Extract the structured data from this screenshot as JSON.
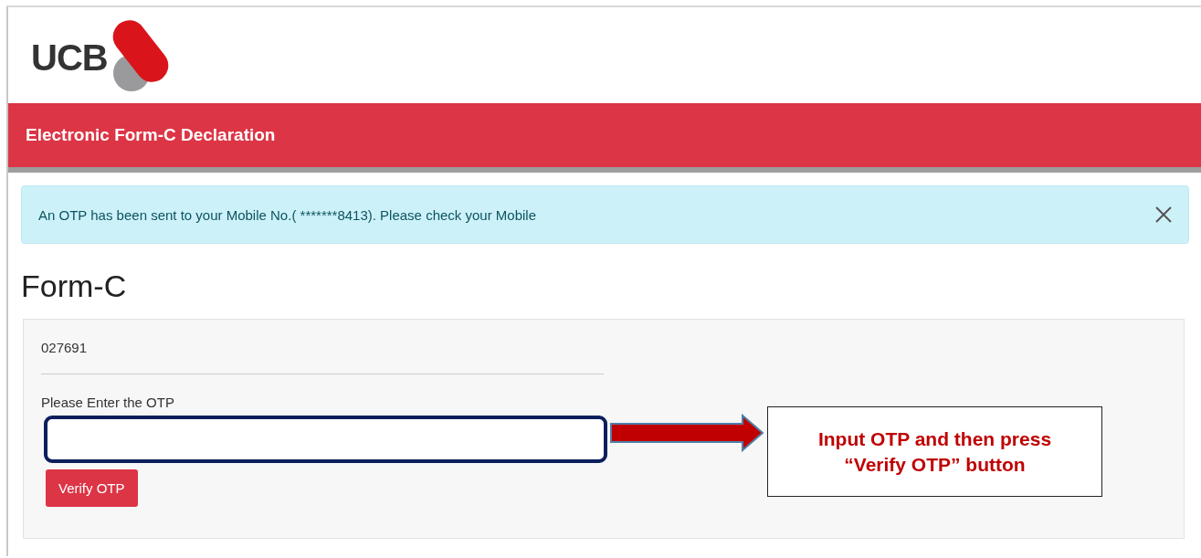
{
  "logo": {
    "text": "UCB"
  },
  "header": {
    "title": "Electronic Form-C Declaration"
  },
  "alert": {
    "message": "An OTP has been sent to your Mobile No.( *******8413). Please check your Mobile"
  },
  "heading": "Form-C",
  "form": {
    "reference": "027691",
    "label": "Please Enter the OTP",
    "button": "Verify OTP"
  },
  "annotation": {
    "text_lines": [
      "Input OTP and then press",
      "“Verify OTP” button"
    ]
  }
}
